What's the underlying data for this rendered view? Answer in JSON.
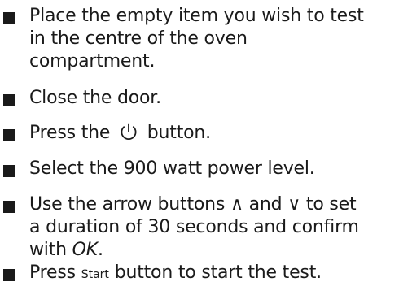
{
  "instructions": {
    "steps": [
      {
        "lines": [
          "Place the empty item you wish to test",
          "in the centre of the oven",
          "compartment."
        ]
      },
      {
        "text": "Close the door."
      },
      {
        "before": "Press the ",
        "icon": "power-icon",
        "after": " button."
      },
      {
        "text": "Select the 900 watt power level."
      },
      {
        "line1": "Use the arrow buttons ∧ and ∨ to set",
        "line2": "a duration of 30 seconds and confirm",
        "line3_before": "with ",
        "line3_italic": "OK",
        "line3_after": "."
      },
      {
        "before": "Press ",
        "start_label": "Start",
        "after": " button to start the test."
      }
    ]
  },
  "colors": {
    "text": "#1a1a1a",
    "bullet": "#1a1a1a"
  }
}
